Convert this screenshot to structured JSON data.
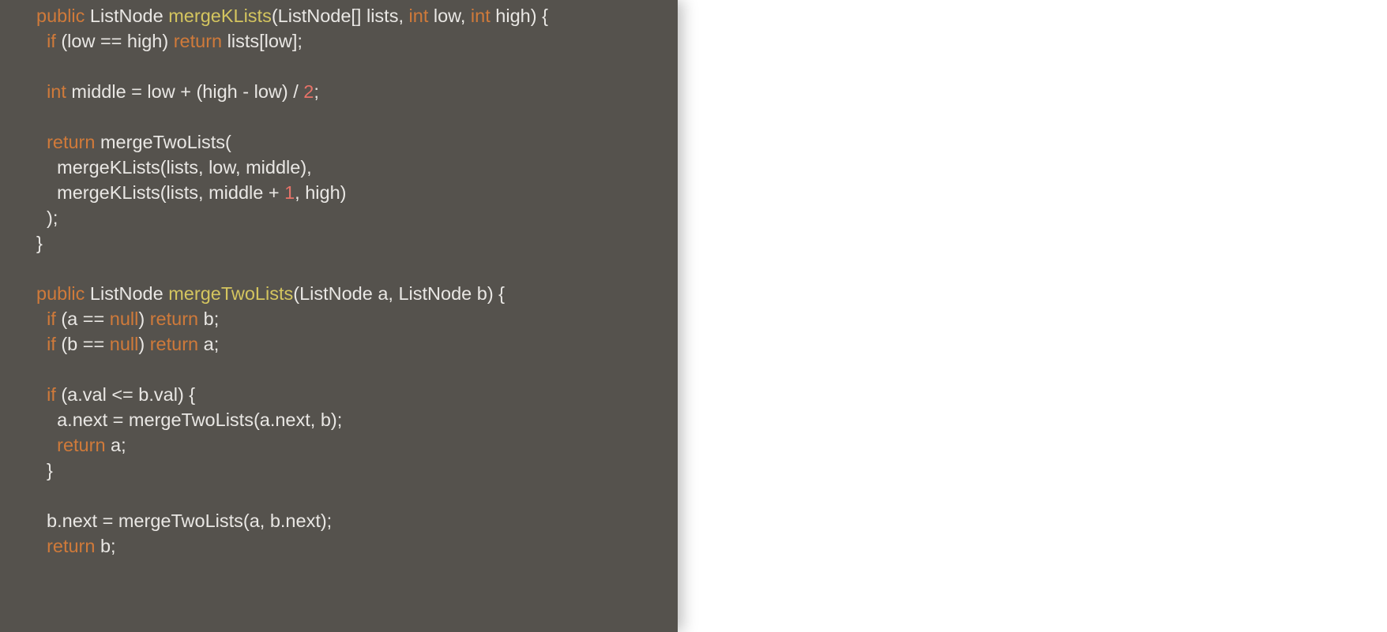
{
  "code": {
    "lines": [
      [
        {
          "cls": "kw",
          "t": "public"
        },
        {
          "t": " ListNode "
        },
        {
          "cls": "fn",
          "t": "mergeKLists"
        },
        {
          "t": "(ListNode[] lists, "
        },
        {
          "cls": "kw",
          "t": "int"
        },
        {
          "t": " low, "
        },
        {
          "cls": "kw",
          "t": "int"
        },
        {
          "t": " high) {"
        }
      ],
      [
        {
          "t": "  "
        },
        {
          "cls": "kw",
          "t": "if"
        },
        {
          "t": " (low == high) "
        },
        {
          "cls": "kw",
          "t": "return"
        },
        {
          "t": " lists[low];"
        }
      ],
      [
        {
          "t": ""
        }
      ],
      [
        {
          "t": "  "
        },
        {
          "cls": "kw",
          "t": "int"
        },
        {
          "t": " middle = low + (high - low) / "
        },
        {
          "cls": "num",
          "t": "2"
        },
        {
          "t": ";"
        }
      ],
      [
        {
          "t": ""
        }
      ],
      [
        {
          "t": "  "
        },
        {
          "cls": "kw",
          "t": "return"
        },
        {
          "t": " mergeTwoLists("
        }
      ],
      [
        {
          "t": "    mergeKLists(lists, low, middle),"
        }
      ],
      [
        {
          "t": "    mergeKLists(lists, middle + "
        },
        {
          "cls": "num",
          "t": "1"
        },
        {
          "t": ", high)"
        }
      ],
      [
        {
          "t": "  );"
        }
      ],
      [
        {
          "t": "}"
        }
      ],
      [
        {
          "t": ""
        }
      ],
      [
        {
          "cls": "kw",
          "t": "public"
        },
        {
          "t": " ListNode "
        },
        {
          "cls": "fn",
          "t": "mergeTwoLists"
        },
        {
          "t": "(ListNode a, ListNode b) {"
        }
      ],
      [
        {
          "t": "  "
        },
        {
          "cls": "kw",
          "t": "if"
        },
        {
          "t": " (a == "
        },
        {
          "cls": "null",
          "t": "null"
        },
        {
          "t": ") "
        },
        {
          "cls": "kw",
          "t": "return"
        },
        {
          "t": " b;"
        }
      ],
      [
        {
          "t": "  "
        },
        {
          "cls": "kw",
          "t": "if"
        },
        {
          "t": " (b == "
        },
        {
          "cls": "null",
          "t": "null"
        },
        {
          "t": ") "
        },
        {
          "cls": "kw",
          "t": "return"
        },
        {
          "t": " a;"
        }
      ],
      [
        {
          "t": ""
        }
      ],
      [
        {
          "t": "  "
        },
        {
          "cls": "kw",
          "t": "if"
        },
        {
          "t": " (a.val <= b.val) {"
        }
      ],
      [
        {
          "t": "    a.next = mergeTwoLists(a.next, b);"
        }
      ],
      [
        {
          "t": "    "
        },
        {
          "cls": "kw",
          "t": "return"
        },
        {
          "t": " a;"
        }
      ],
      [
        {
          "t": "  }"
        }
      ],
      [
        {
          "t": ""
        }
      ],
      [
        {
          "t": "  b.next = mergeTwoLists(a, b.next);"
        }
      ],
      [
        {
          "t": "  "
        },
        {
          "cls": "kw",
          "t": "return"
        },
        {
          "t": " b;"
        }
      ]
    ]
  }
}
